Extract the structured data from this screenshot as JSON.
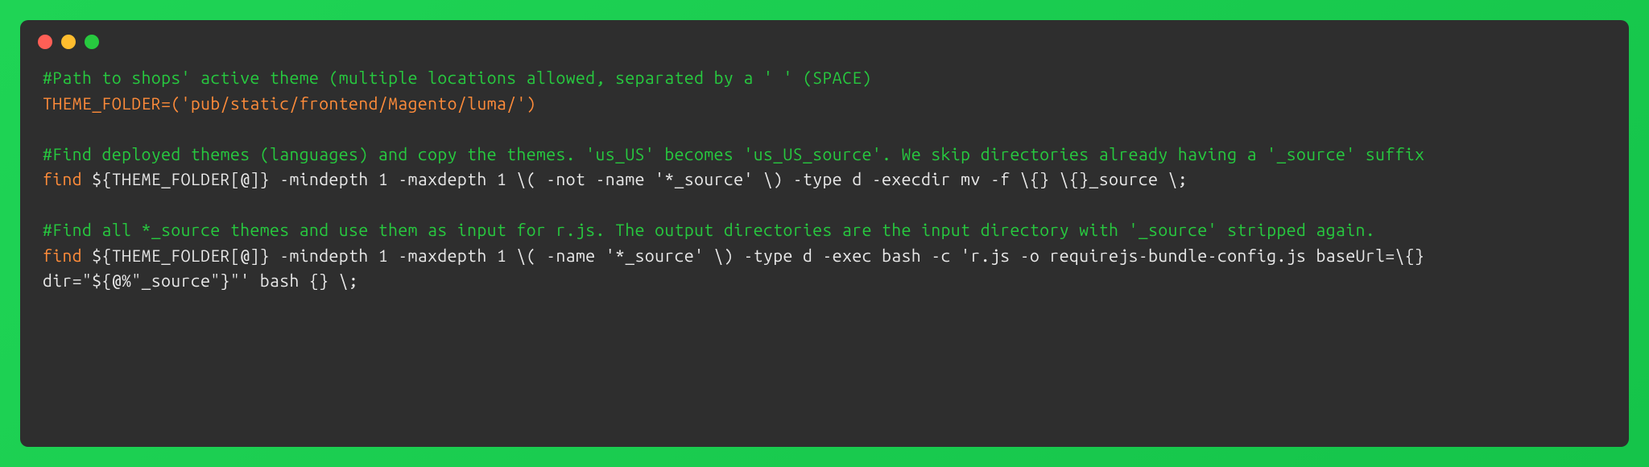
{
  "code": {
    "line1_comment": "#Path to shops' active theme (multiple locations allowed, separated by a ' ' (SPACE)",
    "line2_assign": "THEME_FOLDER=('pub/static/frontend/Magento/luma/')",
    "line4_comment": "#Find deployed themes (languages) and copy the themes. 'us_US' becomes 'us_US_source'. We skip directories already having a '_source' suffix",
    "line5_cmd": "find",
    "line5_rest": " ${THEME_FOLDER[@]} -mindepth 1 -maxdepth 1 \\( -not -name '*_source' \\) -type d -execdir mv -f \\{} \\{}_source \\;",
    "line7_comment": "#Find all *_source themes and use them as input for r.js. The output directories are the input directory with '_source' stripped again.",
    "line8_cmd": "find",
    "line8_rest": " ${THEME_FOLDER[@]} -mindepth 1 -maxdepth 1 \\( -name '*_source' \\) -type d -exec bash -c 'r.js -o requirejs-bundle-config.js baseUrl=\\{} dir=\"${@%\"_source\"}\"' bash {} \\;"
  }
}
